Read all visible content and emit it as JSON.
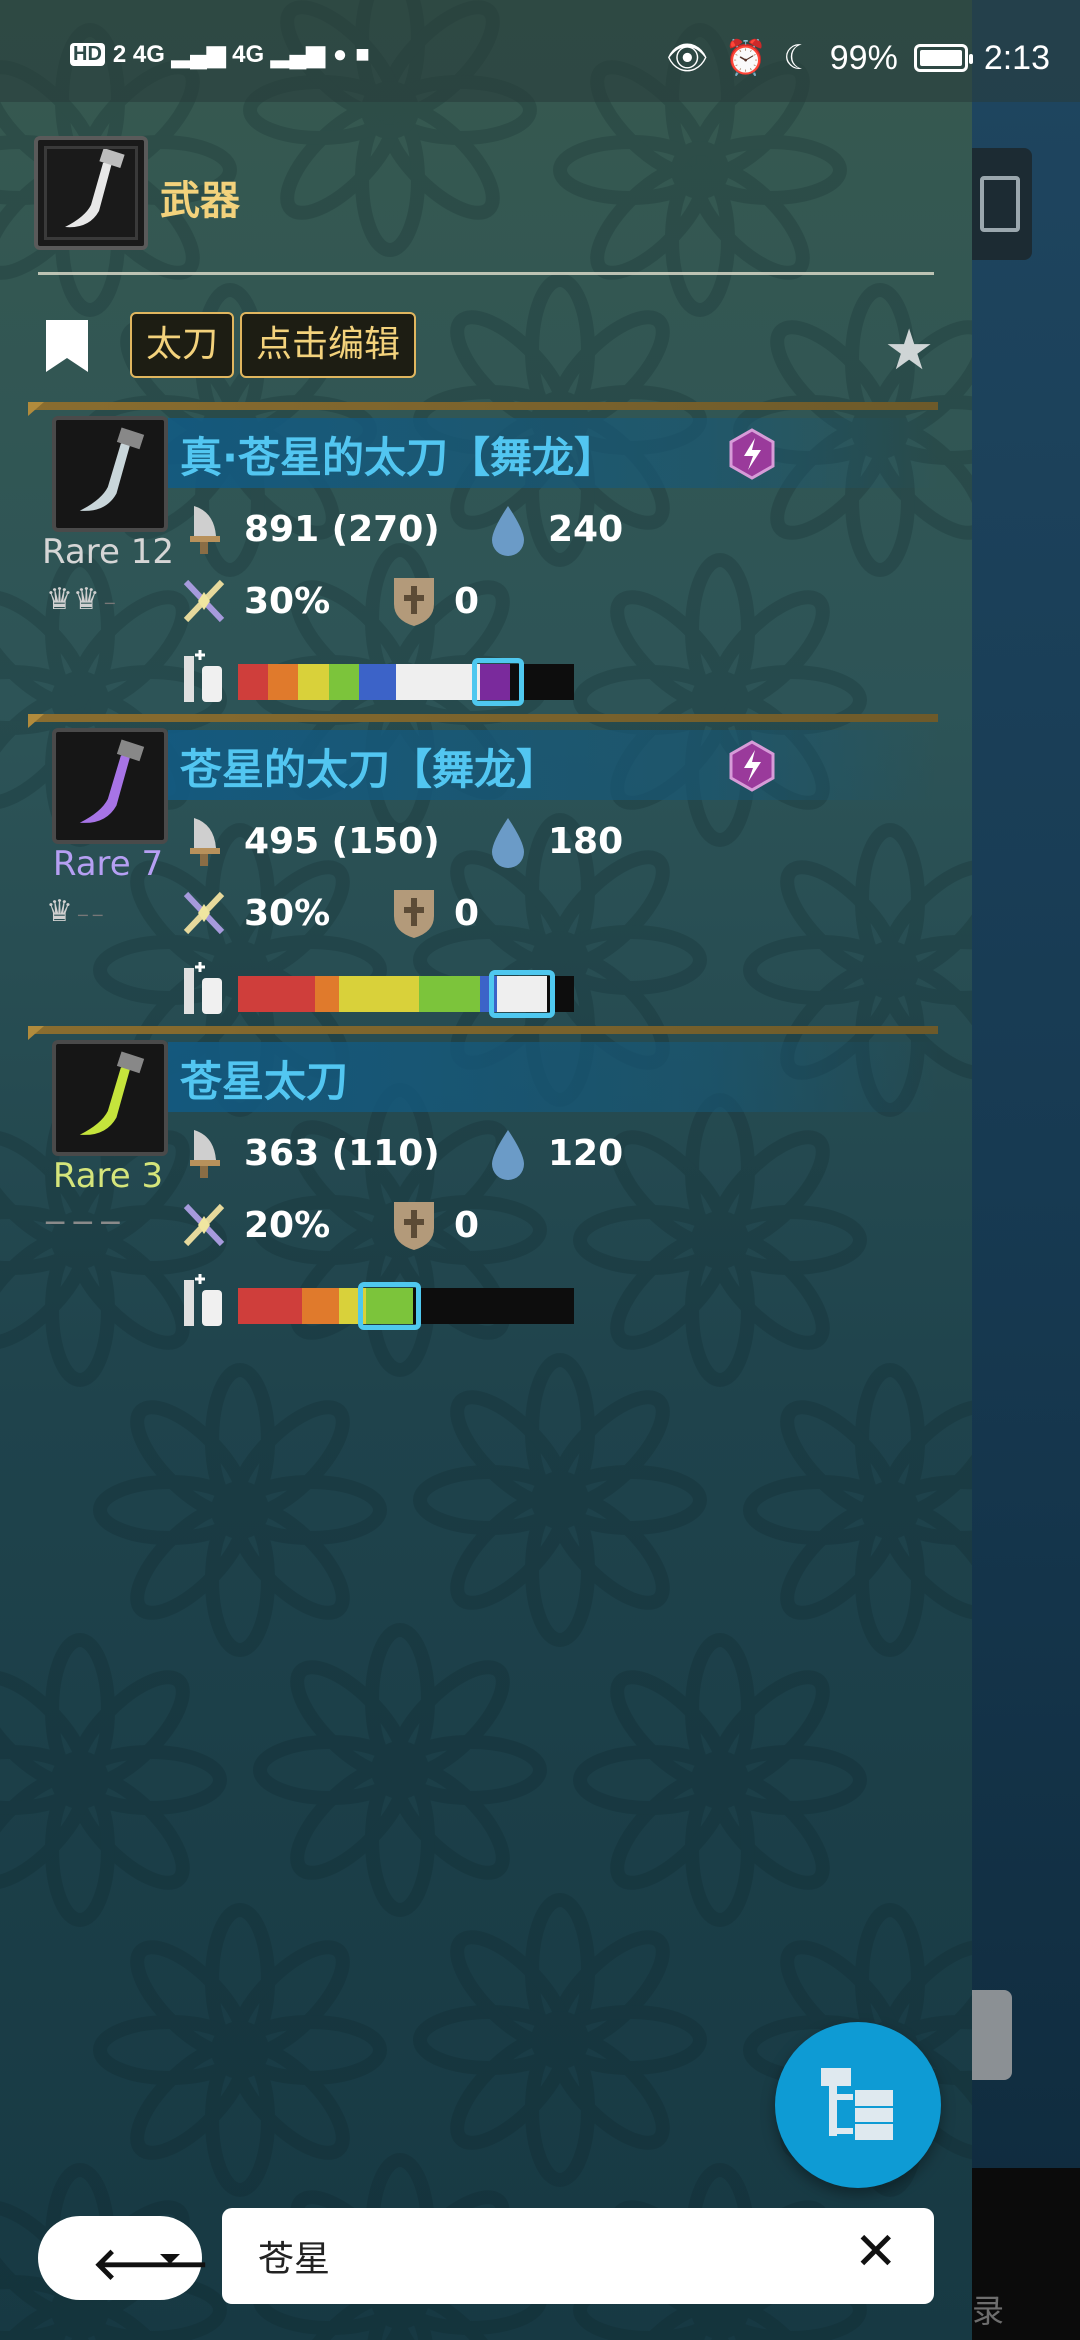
{
  "status_bar": {
    "left_text": "HD 2 4G 4G",
    "battery_text": "99%",
    "time": "2:13"
  },
  "header": {
    "title": "武器"
  },
  "filters": {
    "chips": [
      "太刀",
      "点击编辑"
    ]
  },
  "weapons": [
    {
      "name": "真·苍星的太刀【舞龙】",
      "rare": "Rare 12",
      "rare_color": "#d6d6d6",
      "attack": "891 (270)",
      "element": "240",
      "affinity": "30%",
      "defense": "0",
      "has_element_icon": true,
      "slots": "2 deco",
      "sharpness_colors": [
        "#cf3e3b",
        "#e07a2c",
        "#d9d13a",
        "#7cc43b",
        "#3c63c8",
        "#efefef",
        "#7a2a9c"
      ],
      "sharpness_fractions": [
        0.09,
        0.09,
        0.09,
        0.09,
        0.11,
        0.25,
        0.09
      ]
    },
    {
      "name": "苍星的太刀【舞龙】",
      "rare": "Rare 7",
      "rare_color": "#b69ff3",
      "attack": "495 (150)",
      "element": "180",
      "affinity": "30%",
      "defense": "0",
      "has_element_icon": true,
      "slots": "1 deco",
      "sharpness_colors": [
        "#cf3e3b",
        "#e07a2c",
        "#d9d13a",
        "#7cc43b",
        "#3c63c8",
        "#efefef"
      ],
      "sharpness_fractions": [
        0.23,
        0.07,
        0.24,
        0.18,
        0.05,
        0.15
      ]
    },
    {
      "name": "苍星太刀",
      "rare": "Rare 3",
      "rare_color": "#d5e57b",
      "attack": "363 (110)",
      "element": "120",
      "affinity": "20%",
      "defense": "0",
      "has_element_icon": false,
      "slots": "none",
      "sharpness_colors": [
        "#cf3e3b",
        "#e07a2c",
        "#d9d13a",
        "#7cc43b",
        "#0d0d0d"
      ],
      "sharpness_fractions": [
        0.19,
        0.11,
        0.08,
        0.14,
        0.22
      ]
    }
  ],
  "search": {
    "value": "苍星"
  },
  "background_app": {
    "peek_text": "录"
  },
  "colors": {
    "accent": "#f3d27c",
    "name_blue": "#52c6f1",
    "fab": "#0e9bd4"
  }
}
